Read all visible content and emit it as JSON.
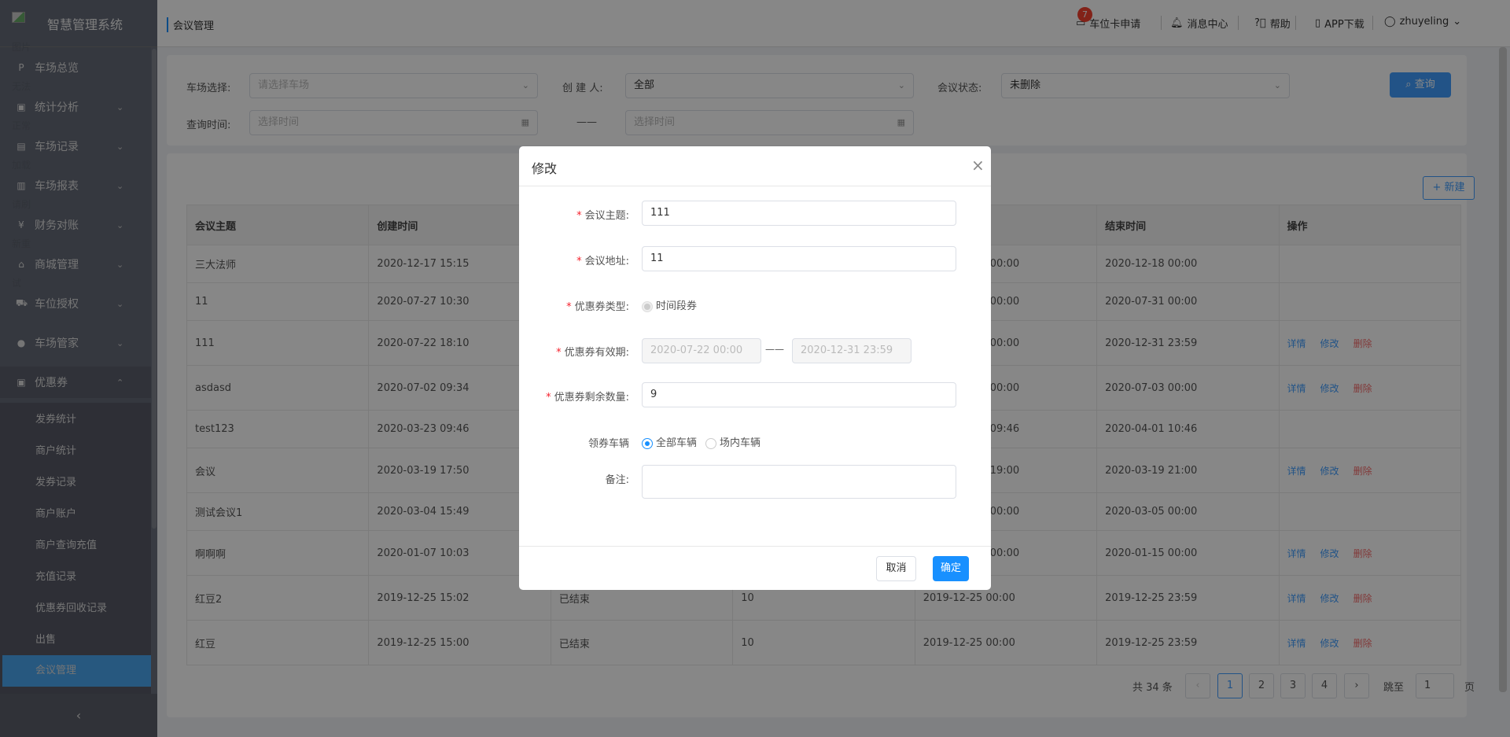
{
  "app": {
    "title": "智慧管理系统",
    "logo_alt": "图片无法正常加载请刷新重试"
  },
  "sidebar": {
    "items": [
      {
        "label": "车场总览",
        "icon": "parking-icon"
      },
      {
        "label": "统计分析",
        "icon": "monitor-chart-icon"
      },
      {
        "label": "车场记录",
        "icon": "document-icon"
      },
      {
        "label": "车场报表",
        "icon": "report-icon"
      },
      {
        "label": "财务对账",
        "icon": "yen-icon"
      },
      {
        "label": "商城管理",
        "icon": "store-icon"
      },
      {
        "label": "车位授权",
        "icon": "car-icon"
      },
      {
        "label": "车场管家",
        "icon": "user-icon"
      },
      {
        "label": "优惠券",
        "icon": "ticket-icon"
      }
    ],
    "sub_items": [
      "发券统计",
      "商户统计",
      "发券记录",
      "商户账户",
      "商户查询充值",
      "充值记录",
      "优惠券回收记录",
      "出售",
      "会议管理"
    ],
    "collapse": "‹"
  },
  "header": {
    "breadcrumb": "会议管理",
    "badge_count": "7",
    "parking_card": "车位卡申请",
    "messages": "消息中心",
    "help": "帮助",
    "app_download": "APP下载",
    "user": "zhuyeling"
  },
  "filters": {
    "lot_label": "车场选择:",
    "lot_placeholder": "请选择车场",
    "creator_label": "创 建 人:",
    "creator_value": "全部",
    "status_label": "会议状态:",
    "status_value": "未删除",
    "time_label": "查询时间:",
    "time_placeholder": "选择时间",
    "time_sep": "——",
    "time_placeholder2": "选择时间",
    "search": "查询"
  },
  "table": {
    "new_button": "+ 新建",
    "columns": [
      "会议主题",
      "创建时间",
      "",
      "",
      "",
      "结束时间",
      "操作"
    ],
    "rows": [
      {
        "c": [
          "三大法师",
          "2020-12-17 15:15",
          "",
          "",
          "00:00",
          "2020-12-18 00:00"
        ],
        "ops": false
      },
      {
        "c": [
          "11",
          "2020-07-27 10:30",
          "",
          "",
          "00:00",
          "2020-07-31 00:00"
        ],
        "ops": false
      },
      {
        "c": [
          "111",
          "2020-07-22 18:10",
          "",
          "",
          "00:00",
          "2020-12-31 23:59"
        ],
        "ops": true
      },
      {
        "c": [
          "asdasd",
          "2020-07-02 09:34",
          "",
          "",
          "00:00",
          "2020-07-03 00:00"
        ],
        "ops": true
      },
      {
        "c": [
          "test123",
          "2020-03-23 09:46",
          "",
          "",
          "09:46",
          "2020-04-01 10:46"
        ],
        "ops": false
      },
      {
        "c": [
          "会议",
          "2020-03-19 17:50",
          "",
          "",
          "19:00",
          "2020-03-19 21:00"
        ],
        "ops": true
      },
      {
        "c": [
          "测试会议1",
          "2020-03-04 15:49",
          "",
          "",
          "00:00",
          "2020-03-05 00:00"
        ],
        "ops": false
      },
      {
        "c": [
          "啊啊啊",
          "2020-01-07 10:03",
          "",
          "",
          "00:00",
          "2020-01-15 00:00"
        ],
        "ops": true
      },
      {
        "c": [
          "红豆2",
          "2019-12-25 15:02",
          "已结束",
          "10",
          "2019-12-25 00:00",
          "2019-12-25 23:59"
        ],
        "ops": true
      },
      {
        "c": [
          "红豆",
          "2019-12-25 15:00",
          "已结束",
          "10",
          "2019-12-25 00:00",
          "2019-12-25 23:59"
        ],
        "ops": true
      }
    ],
    "ops": {
      "detail": "详情",
      "edit": "修改",
      "delete": "删除"
    }
  },
  "pagination": {
    "total": "共 34 条",
    "prev": "‹",
    "pages": [
      "1",
      "2",
      "3",
      "4"
    ],
    "current": "1",
    "next": "›",
    "jump_label": "跳至",
    "jump_value": "1",
    "page_suffix": "页"
  },
  "modal": {
    "title": "修改",
    "close": "×",
    "topic_label": "会议主题:",
    "topic_value": "111",
    "address_label": "会议地址:",
    "address_value": "11",
    "type_label": "优惠券类型:",
    "type_option": "时间段券",
    "validity_label": "优惠券有效期:",
    "validity_start": "2020-07-22 00:00",
    "validity_sep": "——",
    "validity_end": "2020-12-31 23:59",
    "remaining_label": "优惠券剩余数量:",
    "remaining_value": "9",
    "vehicle_label": "领券车辆",
    "vehicle_all": "全部车辆",
    "vehicle_inside": "场内车辆",
    "remark_label": "备注:",
    "remark_value": "",
    "cancel": "取消",
    "confirm": "确定"
  },
  "colors": {
    "accent": "#409eff",
    "danger": "#f56c6c",
    "badge": "#f5402f"
  }
}
